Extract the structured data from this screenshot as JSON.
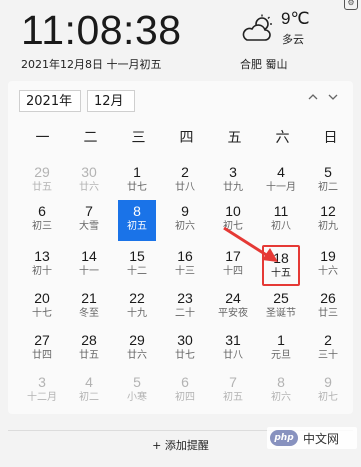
{
  "header": {
    "time": "11:08:38",
    "date_line": "2021年12月8日 十一月初五",
    "temperature": "9℃",
    "condition": "多云",
    "city": "合肥 蜀山"
  },
  "controls": {
    "year": "2021年",
    "month": "12月",
    "prev_icon": "chevron-up-icon",
    "next_icon": "chevron-down-icon"
  },
  "weekdays": [
    "一",
    "二",
    "三",
    "四",
    "五",
    "六",
    "日"
  ],
  "weeks": [
    [
      {
        "d": "29",
        "l": "廿五",
        "t": "other"
      },
      {
        "d": "30",
        "l": "廿六",
        "t": "other"
      },
      {
        "d": "1",
        "l": "廿七",
        "t": "cur"
      },
      {
        "d": "2",
        "l": "廿八",
        "t": "cur"
      },
      {
        "d": "3",
        "l": "廿九",
        "t": "cur"
      },
      {
        "d": "4",
        "l": "十一月",
        "t": "cur"
      },
      {
        "d": "5",
        "l": "初二",
        "t": "cur"
      }
    ],
    [
      {
        "d": "6",
        "l": "初三",
        "t": "cur"
      },
      {
        "d": "7",
        "l": "大雪",
        "t": "cur"
      },
      {
        "d": "8",
        "l": "初五",
        "t": "today"
      },
      {
        "d": "9",
        "l": "初六",
        "t": "cur"
      },
      {
        "d": "10",
        "l": "初七",
        "t": "cur"
      },
      {
        "d": "11",
        "l": "初八",
        "t": "cur"
      },
      {
        "d": "12",
        "l": "初九",
        "t": "cur"
      }
    ],
    [
      {
        "d": "13",
        "l": "初十",
        "t": "cur"
      },
      {
        "d": "14",
        "l": "十一",
        "t": "cur"
      },
      {
        "d": "15",
        "l": "十二",
        "t": "cur"
      },
      {
        "d": "16",
        "l": "十三",
        "t": "cur"
      },
      {
        "d": "17",
        "l": "十四",
        "t": "cur"
      },
      {
        "d": "18",
        "l": "十五",
        "t": "mark"
      },
      {
        "d": "19",
        "l": "十六",
        "t": "cur"
      }
    ],
    [
      {
        "d": "20",
        "l": "十七",
        "t": "cur"
      },
      {
        "d": "21",
        "l": "冬至",
        "t": "cur"
      },
      {
        "d": "22",
        "l": "十九",
        "t": "cur"
      },
      {
        "d": "23",
        "l": "二十",
        "t": "cur"
      },
      {
        "d": "24",
        "l": "平安夜",
        "t": "cur"
      },
      {
        "d": "25",
        "l": "圣诞节",
        "t": "cur"
      },
      {
        "d": "26",
        "l": "廿三",
        "t": "cur"
      }
    ],
    [
      {
        "d": "27",
        "l": "廿四",
        "t": "cur"
      },
      {
        "d": "28",
        "l": "廿五",
        "t": "cur"
      },
      {
        "d": "29",
        "l": "廿六",
        "t": "cur"
      },
      {
        "d": "30",
        "l": "廿七",
        "t": "cur"
      },
      {
        "d": "31",
        "l": "廿八",
        "t": "cur"
      },
      {
        "d": "1",
        "l": "元旦",
        "t": "cur"
      },
      {
        "d": "2",
        "l": "三十",
        "t": "cur"
      }
    ],
    [
      {
        "d": "3",
        "l": "十二月",
        "t": "other"
      },
      {
        "d": "4",
        "l": "初二",
        "t": "other"
      },
      {
        "d": "5",
        "l": "小寒",
        "t": "other"
      },
      {
        "d": "6",
        "l": "初四",
        "t": "other"
      },
      {
        "d": "7",
        "l": "初五",
        "t": "other"
      },
      {
        "d": "8",
        "l": "初六",
        "t": "other"
      },
      {
        "d": "9",
        "l": "初七",
        "t": "other"
      }
    ]
  ],
  "footer": {
    "add_reminder": "+ 添加提醒"
  },
  "watermark": {
    "logo": "php",
    "text": "中文网"
  },
  "colors": {
    "today_bg": "#1a73e8",
    "highlight_border": "#e53935"
  }
}
